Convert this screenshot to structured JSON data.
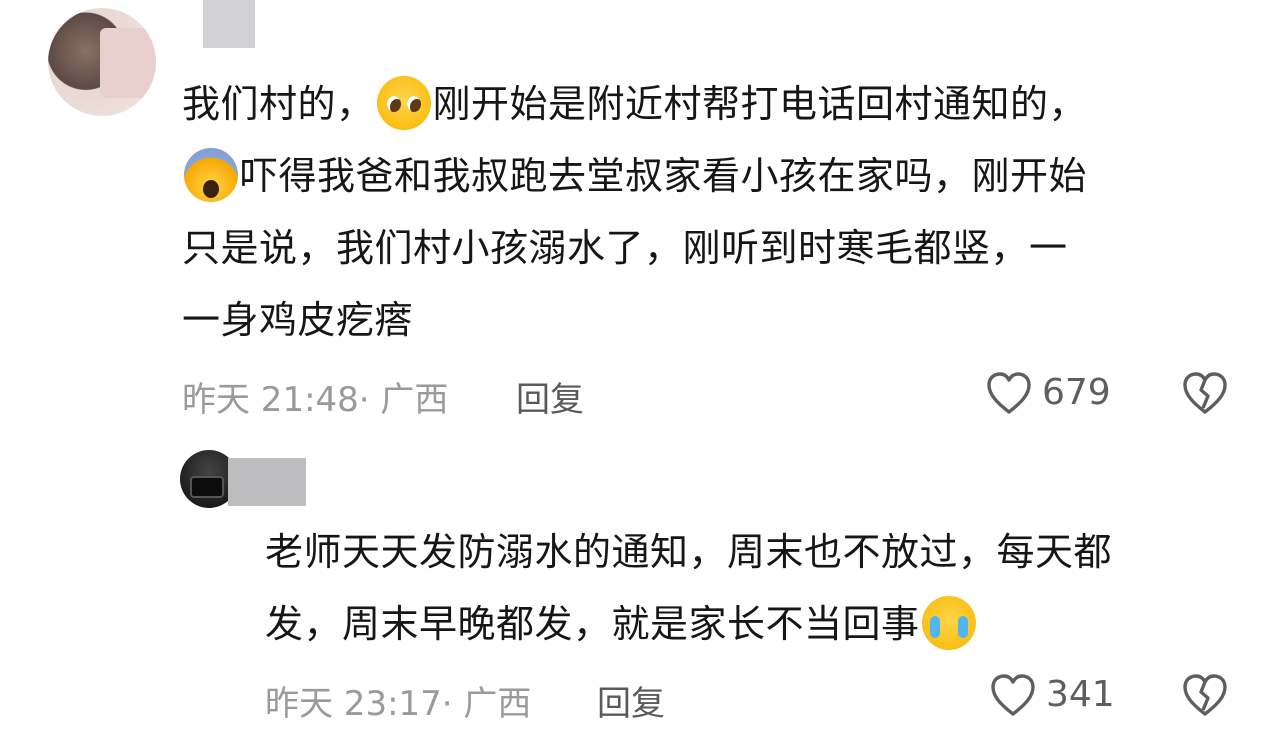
{
  "comments": [
    {
      "lines": [
        [
          "我们村的，",
          "pleading-face-emoji",
          "刚开始是附近村帮打电话回村通知的，"
        ],
        [
          "screaming-face-emoji",
          "吓得我爸和我叔跑去堂叔家看小孩在家吗，刚开始"
        ],
        [
          "只是说，我们村小孩溺水了，刚听到时寒毛都竖，一"
        ],
        [
          "一身鸡皮疙瘩"
        ]
      ],
      "time": "昨天 21:48· 广西",
      "reply_label": "回复",
      "like_count": "679"
    },
    {
      "lines": [
        [
          "老师天天发防溺水的通知，周末也不放过，每天都"
        ],
        [
          "发，周末早晚都发，就是家长不当回事",
          "crying-face-emoji"
        ]
      ],
      "time": "昨天 23:17· 广西",
      "reply_label": "回复",
      "like_count": "341"
    }
  ],
  "icons": {
    "like": "heart-outline-icon",
    "dislike": "broken-heart-icon"
  },
  "colors": {
    "text": "#161616",
    "meta": "#9a9a9a",
    "reply": "#5a5a5a",
    "icon": "#5e5e5e"
  }
}
